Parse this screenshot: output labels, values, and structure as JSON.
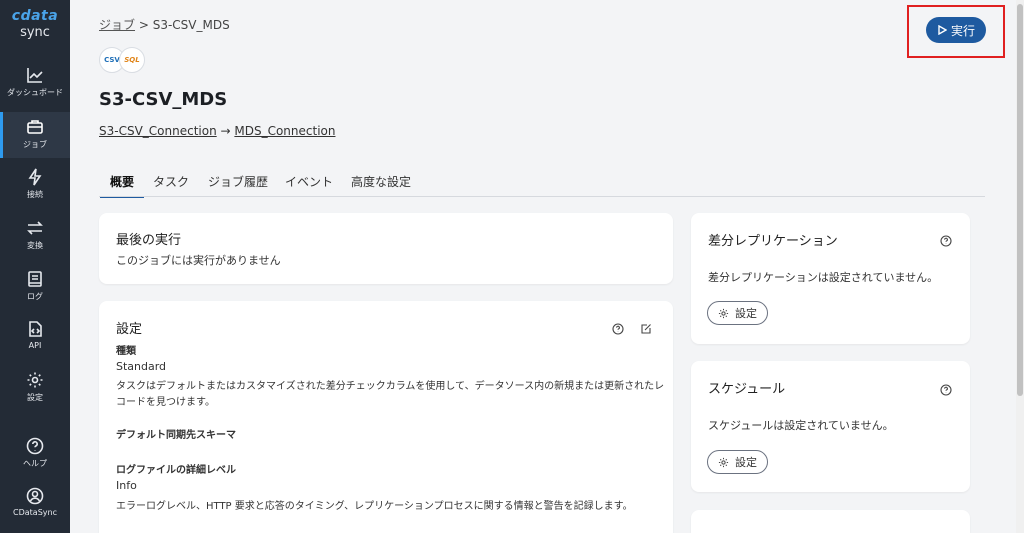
{
  "sidebar": {
    "logo_brand": "cdata",
    "logo_sub": "sync",
    "items": [
      {
        "label": "ダッシュボード",
        "icon": "chart-line-icon"
      },
      {
        "label": "ジョブ",
        "icon": "briefcase-icon"
      },
      {
        "label": "接続",
        "icon": "bolt-icon"
      },
      {
        "label": "変換",
        "icon": "swap-icon"
      },
      {
        "label": "ログ",
        "icon": "log-book-icon"
      },
      {
        "label": "API",
        "icon": "api-file-icon"
      },
      {
        "label": "設定",
        "icon": "gear-icon"
      },
      {
        "label": "ヘルプ",
        "icon": "help-circle-icon"
      },
      {
        "label": "CDataSync",
        "icon": "user-icon"
      }
    ]
  },
  "header": {
    "breadcrumb_root": "ジョブ",
    "breadcrumb_sep": " > ",
    "breadcrumb_current": "S3-CSV_MDS",
    "conn_badge_source": "CSV",
    "conn_badge_dest": "SQL",
    "title": "S3-CSV_MDS",
    "source_connection": "S3-CSV_Connection",
    "arrow": " → ",
    "dest_connection": "MDS_Connection",
    "run_label": "実行"
  },
  "tabs": [
    "概要",
    "タスク",
    "ジョブ履歴",
    "イベント",
    "高度な設定"
  ],
  "last_run": {
    "title": "最後の実行",
    "text": "このジョブには実行がありません"
  },
  "settings": {
    "title": "設定",
    "type_label": "種類",
    "type_value": "Standard",
    "type_desc_line1": "タスクはデフォルトまたはカスタマイズされた差分チェックカラムを使用して、データソース内の新規または更新されたレ",
    "type_desc_line2": "コードを見つけます。",
    "schema_label": "デフォルト同期先スキーマ",
    "log_label": "ログファイルの詳細レベル",
    "log_value": "Info",
    "log_desc": "エラーログレベル、HTTP 要求と応答のタイミング、レプリケーションプロセスに関する情報と警告を記録します。"
  },
  "delta": {
    "title": "差分レプリケーション",
    "text": "差分レプリケーションは設定されていません。",
    "button": "設定"
  },
  "schedule": {
    "title": "スケジュール",
    "text": "スケジュールは設定されていません。",
    "button": "設定"
  },
  "colors": {
    "sidebar_bg": "#232b36",
    "accent": "#1e5aa0",
    "highlight": "#e02020"
  }
}
